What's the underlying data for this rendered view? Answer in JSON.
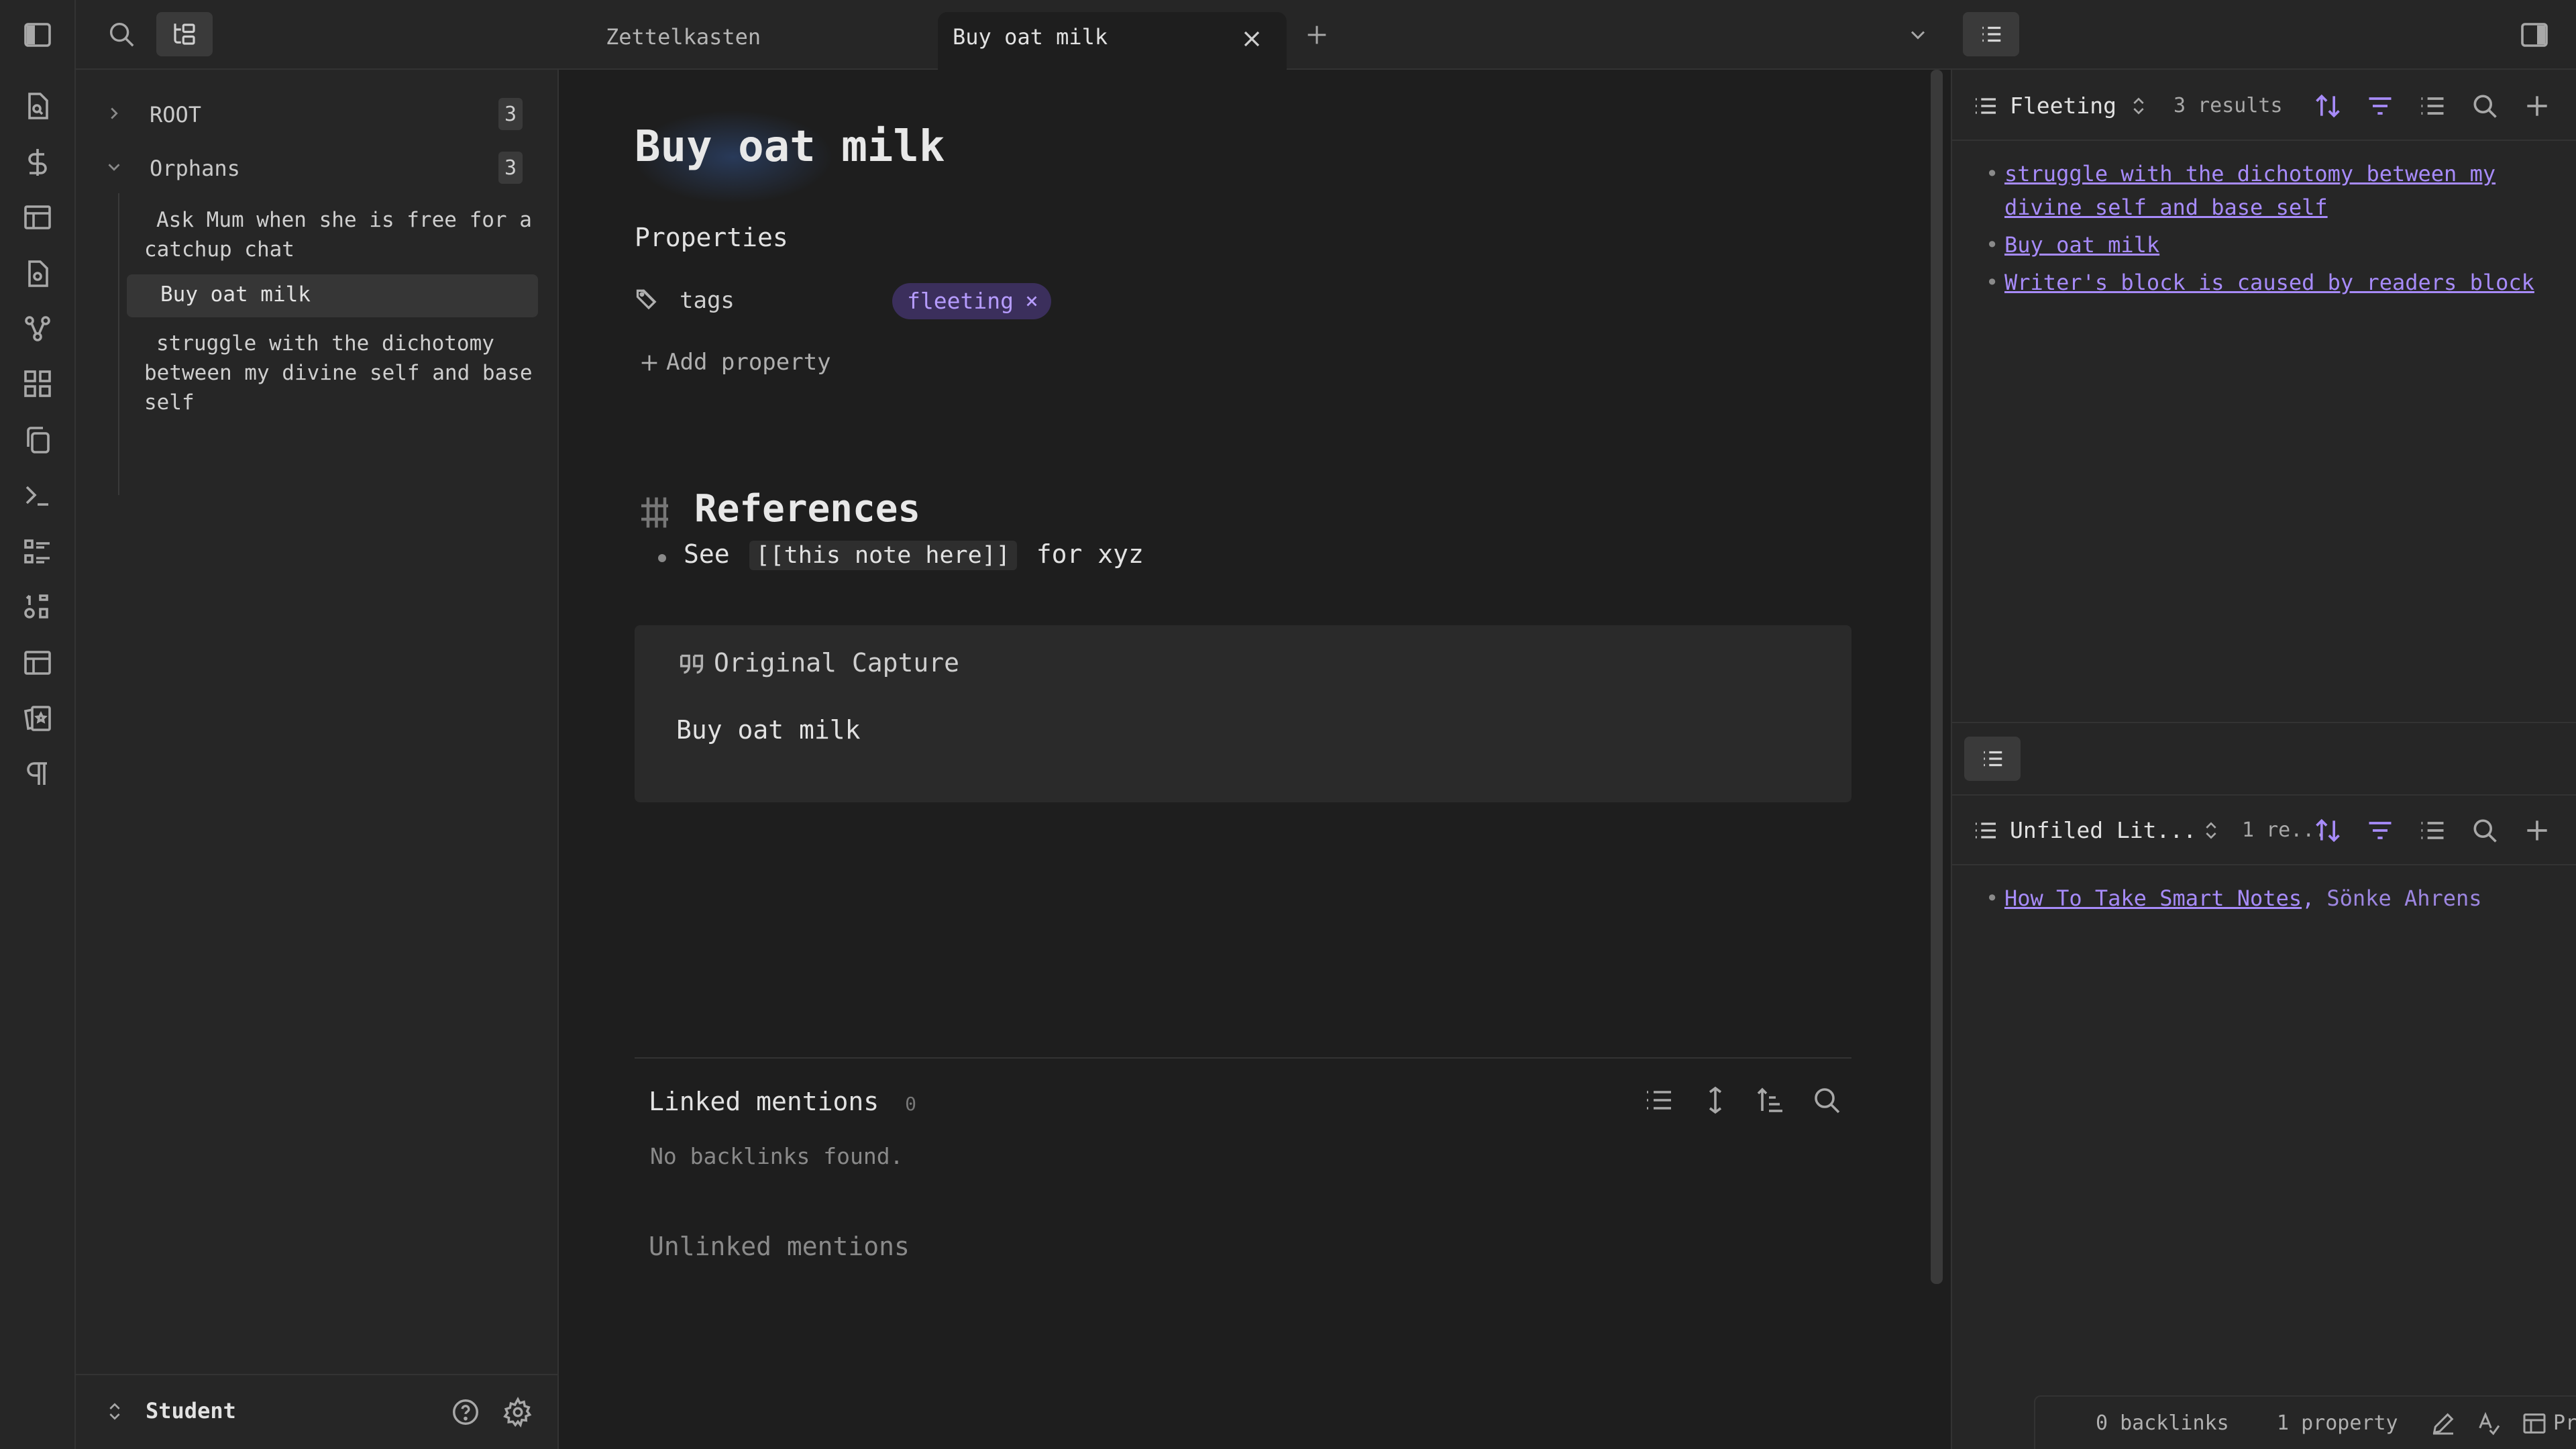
{
  "tabs": [
    {
      "label": "Zettelkasten",
      "active": false
    },
    {
      "label": "Buy oat milk",
      "active": true
    }
  ],
  "explorer": {
    "root": {
      "label": "ROOT",
      "count": "3"
    },
    "orphans": {
      "label": "Orphans",
      "count": "3"
    },
    "notes": [
      {
        "label": "Ask Mum when she is free for a catchup chat"
      },
      {
        "label": "Buy oat milk"
      },
      {
        "label": "struggle with the dichotomy between my divine self and base self"
      }
    ],
    "vault_name": "Student"
  },
  "note": {
    "title": "Buy oat milk",
    "properties_heading": "Properties",
    "property_name": "tags",
    "tag": "fleeting",
    "add_property": "Add property",
    "references_heading": "References",
    "bullet": {
      "prefix": "See",
      "link": "[[this note here]]",
      "suffix": "for xyz"
    },
    "callout_title": "Original Capture",
    "callout_body": "Buy oat milk"
  },
  "backlinks": {
    "linked_label": "Linked mentions",
    "linked_count": "0",
    "empty_text": "No backlinks found.",
    "unlinked_label": "Unlinked mentions"
  },
  "right_top": {
    "view_name": "Fleeting",
    "results": "3 results",
    "items": [
      "struggle with the dichotomy between my divine self and base self",
      "Buy oat milk",
      "Writer's block is caused by readers block"
    ]
  },
  "right_bottom": {
    "view_name": "Unfiled Lit...",
    "results": "1 re...",
    "item_link": "How To Take Smart Notes",
    "item_sep": ",",
    "item_author": "Sönke Ahrens"
  },
  "status": {
    "backlinks": "0 backlinks",
    "properties": "1 property",
    "process": "Process"
  },
  "colors": {
    "accent": "#a78bfa",
    "background": "#1e1e1e",
    "panel": "#262626"
  }
}
